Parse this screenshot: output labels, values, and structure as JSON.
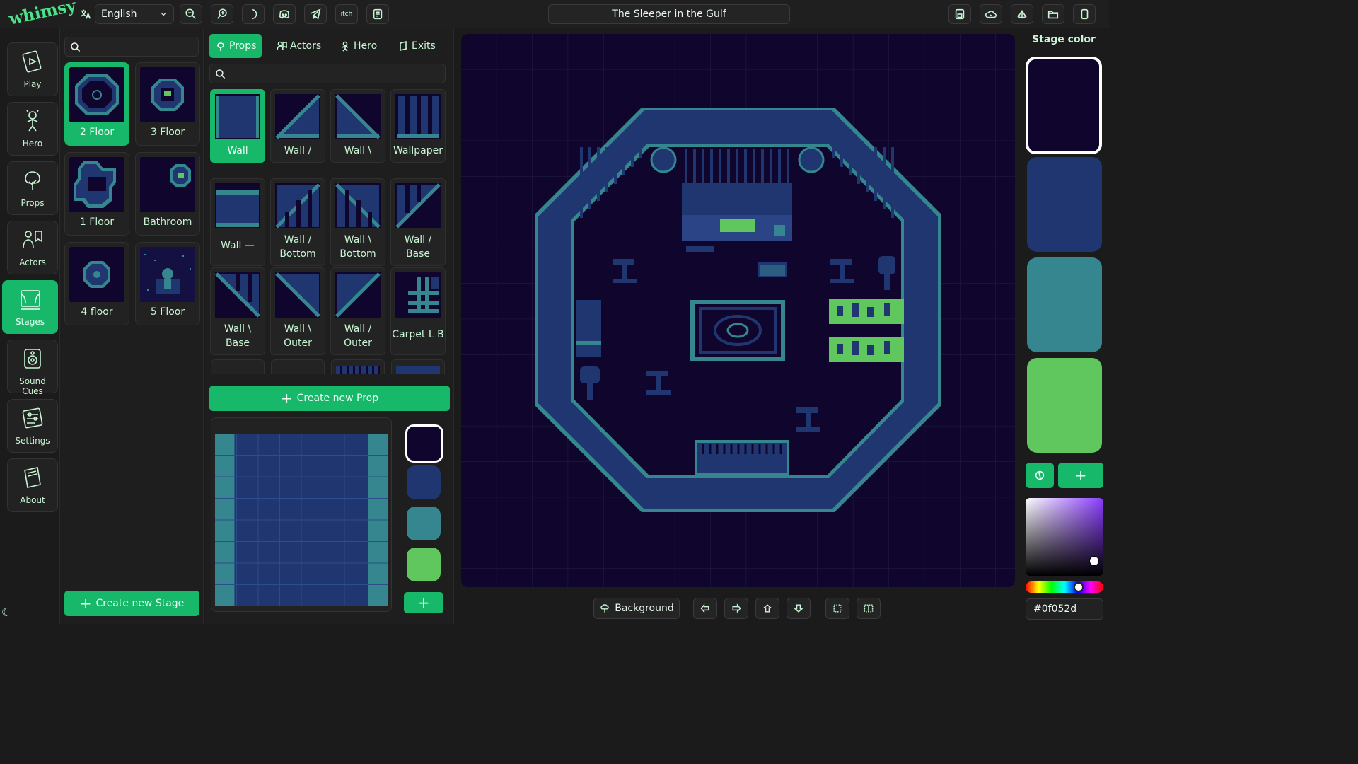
{
  "app": {
    "logo": "whimsy",
    "title": "The Sleeper in the Gulf",
    "language": "English"
  },
  "toolbar_left_icons": [
    "translate-icon",
    "zoom-out-icon",
    "zoom-in-icon",
    "dark-mode-icon",
    "discord-icon",
    "telegram-icon",
    "itch-icon",
    "document-icon"
  ],
  "toolbar_right_icons": [
    "save-icon",
    "cloud-icon",
    "cloud-upload-icon",
    "folder-open-icon",
    "mobile-icon"
  ],
  "itch_label": "itch",
  "nav": [
    {
      "label": "Play",
      "icon": "play-card-icon"
    },
    {
      "label": "Hero",
      "icon": "hero-icon"
    },
    {
      "label": "Props",
      "icon": "tree-icon"
    },
    {
      "label": "Actors",
      "icon": "actors-icon"
    },
    {
      "label": "Stages",
      "icon": "stage-icon",
      "active": true
    },
    {
      "label": "Sound Cues",
      "icon": "speaker-icon"
    },
    {
      "label": "Settings",
      "icon": "settings-icon"
    },
    {
      "label": "About",
      "icon": "book-icon"
    }
  ],
  "stages": [
    {
      "label": "2 Floor",
      "selected": true
    },
    {
      "label": "3 Floor"
    },
    {
      "label": "1 Floor"
    },
    {
      "label": "Bathroom"
    },
    {
      "label": "4 floor"
    },
    {
      "label": "5 Floor"
    }
  ],
  "create_stage": "Create new Stage",
  "tabs": [
    {
      "label": "Props",
      "icon": "props-tab-icon",
      "active": true
    },
    {
      "label": "Actors",
      "icon": "actors-tab-icon"
    },
    {
      "label": "Hero",
      "icon": "hero-tab-icon"
    },
    {
      "label": "Exits",
      "icon": "exits-tab-icon"
    }
  ],
  "props": [
    {
      "line1": "Wall",
      "line2": "",
      "selected": true
    },
    {
      "line1": "Wall /",
      "line2": ""
    },
    {
      "line1": "Wall \\",
      "line2": ""
    },
    {
      "line1": "Wallpaper",
      "line2": ""
    },
    {
      "line1": "Wall —",
      "line2": ""
    },
    {
      "line1": "Wall /",
      "line2": "Bottom"
    },
    {
      "line1": "Wall \\",
      "line2": "Bottom"
    },
    {
      "line1": "Wall /",
      "line2": "Base"
    },
    {
      "line1": "Wall \\",
      "line2": "Base"
    },
    {
      "line1": "Wall \\",
      "line2": "Outer"
    },
    {
      "line1": "Wall /",
      "line2": "Outer"
    },
    {
      "line1": "Carpet L B",
      "line2": ""
    }
  ],
  "create_prop": "Create new Prop",
  "palette": [
    "#0f052d",
    "#203671",
    "#36868f",
    "#5fc75d"
  ],
  "stage_color": {
    "label": "Stage color",
    "hex": "#0f052d"
  },
  "bottom": {
    "background": "Background"
  },
  "bottom_icons": [
    "arrow-left-icon",
    "arrow-right-icon",
    "arrow-up-icon",
    "arrow-down-icon",
    "select-icon",
    "select-area-icon"
  ]
}
